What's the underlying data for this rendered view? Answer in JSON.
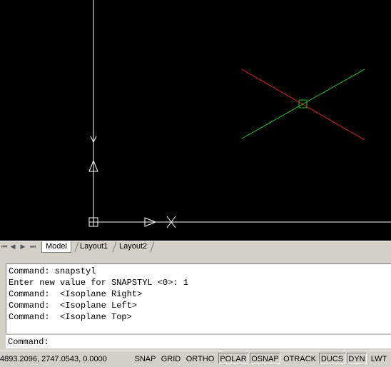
{
  "viewport": {
    "background": "#000000",
    "ucs_x_label": "X",
    "ucs_y_label": "Y",
    "crosshair_colors": {
      "left_axis": "#e02020",
      "right_axis": "#20c020",
      "pickbox": "#20c020"
    }
  },
  "tabs": {
    "nav_first": "⏮",
    "nav_prev": "◀",
    "nav_next": "▶",
    "nav_last": "⏭",
    "items": [
      {
        "label": "Model",
        "active": true
      },
      {
        "label": "Layout1",
        "active": false
      },
      {
        "label": "Layout2",
        "active": false
      }
    ]
  },
  "command": {
    "history": [
      "Command: snapstyl",
      "Enter new value for SNAPSTYL <0>: 1",
      "Command:  <Isoplane Right>",
      "Command:  <Isoplane Left>",
      "Command:  <Isoplane Top>"
    ],
    "prompt": "Command:",
    "input_value": ""
  },
  "status": {
    "coordinates": "4893.2096,  2747.0543, 0.0000",
    "buttons": [
      {
        "label": "SNAP",
        "on": false
      },
      {
        "label": "GRID",
        "on": false
      },
      {
        "label": "ORTHO",
        "on": false
      },
      {
        "label": "POLAR",
        "on": true
      },
      {
        "label": "OSNAP",
        "on": true
      },
      {
        "label": "OTRACK",
        "on": false
      },
      {
        "label": "DUCS",
        "on": true
      },
      {
        "label": "DYN",
        "on": true
      },
      {
        "label": "LWT",
        "on": false
      }
    ]
  }
}
